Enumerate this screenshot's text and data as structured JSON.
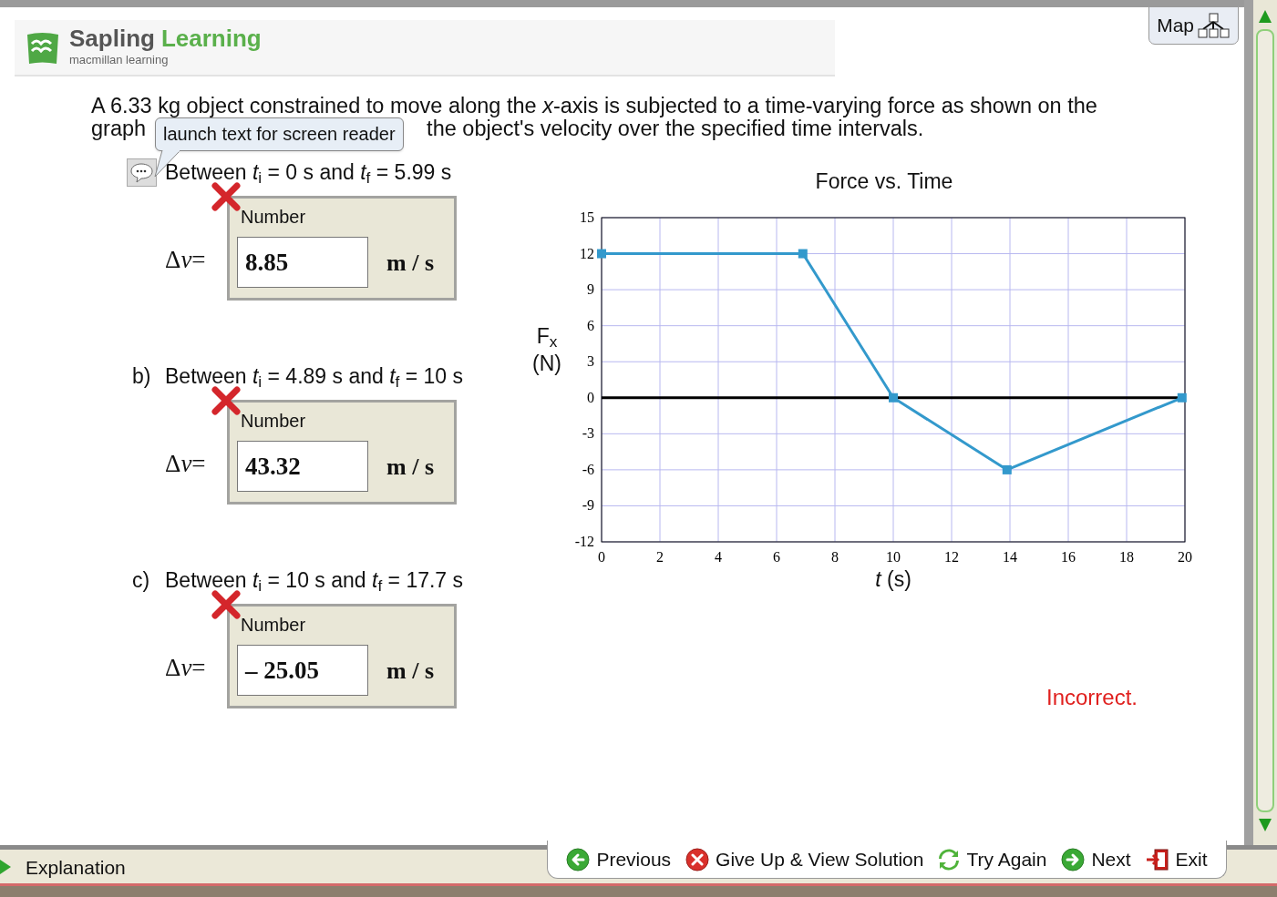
{
  "header": {
    "brand_first": "Sapling",
    "brand_second": "Learning",
    "publisher": "macmillan learning",
    "map_button": "Map"
  },
  "question": {
    "line_1": "A 6.33 kg object constrained to move along the *x*-axis is subjected to a time-varying force as shown on the",
    "line_2_start": "graph",
    "line_2_end": "the object's velocity over the specified time intervals."
  },
  "tooltip": "launch text for screen reader",
  "parts": [
    {
      "text": "Between *t*$_{i}$ = 0 s and *t*$_{f}$ = 5.99 s",
      "correct": false,
      "field_label": "Number",
      "delta": "Δ",
      "variable": "v",
      "equals": "=",
      "value": "8.85",
      "unit": "m / s"
    },
    {
      "prefix": "b)",
      "text": "Between *t*$_{i}$ = 4.89 s and *t*$_{f}$ = 10 s",
      "correct": false,
      "field_label": "Number",
      "delta": "Δ",
      "variable": "v",
      "equals": "=",
      "value": "43.32",
      "unit": "m / s"
    },
    {
      "prefix": "c)",
      "text": "Between *t*$_{i}$ = 10 s and *t*$_{f}$ = 17.7 s",
      "correct": false,
      "field_label": "Number",
      "delta": "Δ",
      "variable": "v",
      "equals": "=",
      "value": "– 25.05",
      "unit": "m / s"
    }
  ],
  "chart": {
    "chart_data": {
      "type": "line",
      "title": "Force vs. Time",
      "xlabel": "*t* (s)",
      "ylabel": "F$_{x}$ (N)",
      "x": [
        0,
        6.9,
        10,
        13.9,
        19.9
      ],
      "series": [
        {
          "color": "#3399cc",
          "marker": "square",
          "values": [
            12,
            12,
            0,
            -6,
            0
          ]
        }
      ],
      "grid": true,
      "xlim": [
        0,
        20
      ],
      "ylim": [
        -12,
        15
      ],
      "xticks": [
        0,
        2,
        4,
        6,
        8,
        10,
        12,
        14,
        16,
        18,
        20
      ],
      "yticks": [
        -12,
        -9,
        -6,
        -3,
        0,
        3,
        6,
        9,
        12,
        15
      ]
    }
  },
  "feedback": "Incorrect.",
  "bottom_bar": {
    "explanation": "Explanation",
    "nav": [
      {
        "kind": "previous",
        "label": "Previous"
      },
      {
        "kind": "give_up",
        "label": "Give Up & View Solution"
      },
      {
        "kind": "try_again",
        "label": "Try Again"
      },
      {
        "kind": "next",
        "label": "Next"
      },
      {
        "kind": "exit",
        "label": "Exit"
      }
    ]
  }
}
